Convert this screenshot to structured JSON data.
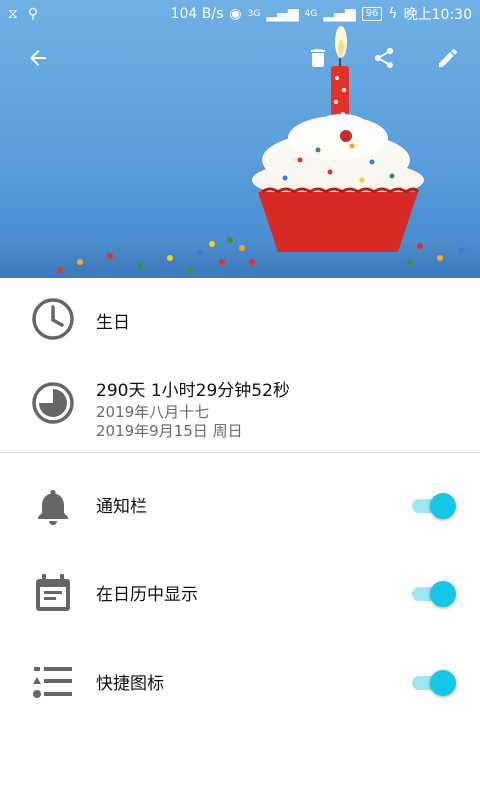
{
  "status_bar": {
    "network_speed": "104 B/s",
    "net_3g": "3G",
    "net_4g": "4G",
    "battery": "96",
    "time": "晚上10:30"
  },
  "toolbar": {
    "back_icon": "arrow-left-icon",
    "delete_icon": "trash-icon",
    "share_icon": "share-icon",
    "edit_icon": "pencil-icon"
  },
  "event": {
    "name": "生日",
    "elapsed": "290天 1小时29分钟52秒",
    "lunar_date": "2019年八月十七",
    "solar_date": "2019年9月15日 周日"
  },
  "settings": [
    {
      "label": "通知栏",
      "enabled": true,
      "icon": "bell-icon"
    },
    {
      "label": "在日历中显示",
      "enabled": true,
      "icon": "calendar-icon"
    },
    {
      "label": "快捷图标",
      "enabled": true,
      "icon": "shortcut-list-icon"
    }
  ],
  "colors": {
    "accent": "#15c7e6",
    "accent_track": "#9de6f2",
    "icon_gray": "#666666"
  }
}
